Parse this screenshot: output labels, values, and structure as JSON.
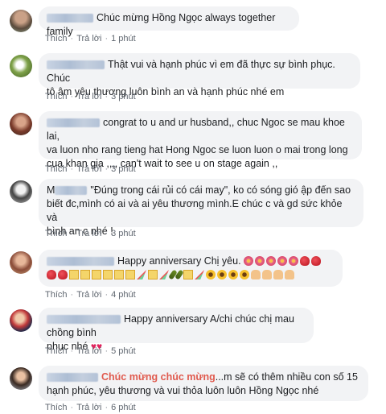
{
  "labels": {
    "like": "Thích",
    "reply": "Trả lời",
    "dot": "·"
  },
  "comments": [
    {
      "text": "Chúc mừng Hồng Ngọc always together family",
      "time": "1 phút"
    },
    {
      "text_line1": "Thật vui và hạnh phúc vì em đã thực sự bình phục. Chúc",
      "text_line2": "tô âm yêu thương luôn bình an và hạnh phúc nhé em",
      "time": "3 phút"
    },
    {
      "text_line1": "congrat to u and ur husband,, chuc Ngoc se mau khoe lai,",
      "text_line2": "va luon nho rang tieng hat Hong Ngoc se luon luon o mai trong long",
      "text_line3": "cua khan gia ,,,, can't wait to see u on stage again ,,",
      "time": "3 phút"
    },
    {
      "name_initial": "M",
      "text_line1": "\"Đúng trong cái rủi có cái may\", ko có sóng gió ập đến sao",
      "text_line2": "biết đc,mình có ai và ai yêu thương mình.E chúc c và gd sức khỏe và",
      "text_line3": "bình an c nhé !",
      "time": "3 phút"
    },
    {
      "text": "Happy anniversary Chị yêu.",
      "time": "4 phút"
    },
    {
      "text_line1": "Happy anniversary A/chi chúc chị mau chồng bình",
      "text_line2": "phục nhé",
      "time": "5 phút"
    },
    {
      "highlight": "Chúc mừng chúc mừng",
      "text_line1": "...m sẽ có thêm nhiều con số 15",
      "text_line2": "hạnh phúc, yêu thương và vui thỏa luôn luôn Hồng Ngọc nhé",
      "time": "6 phút"
    }
  ]
}
